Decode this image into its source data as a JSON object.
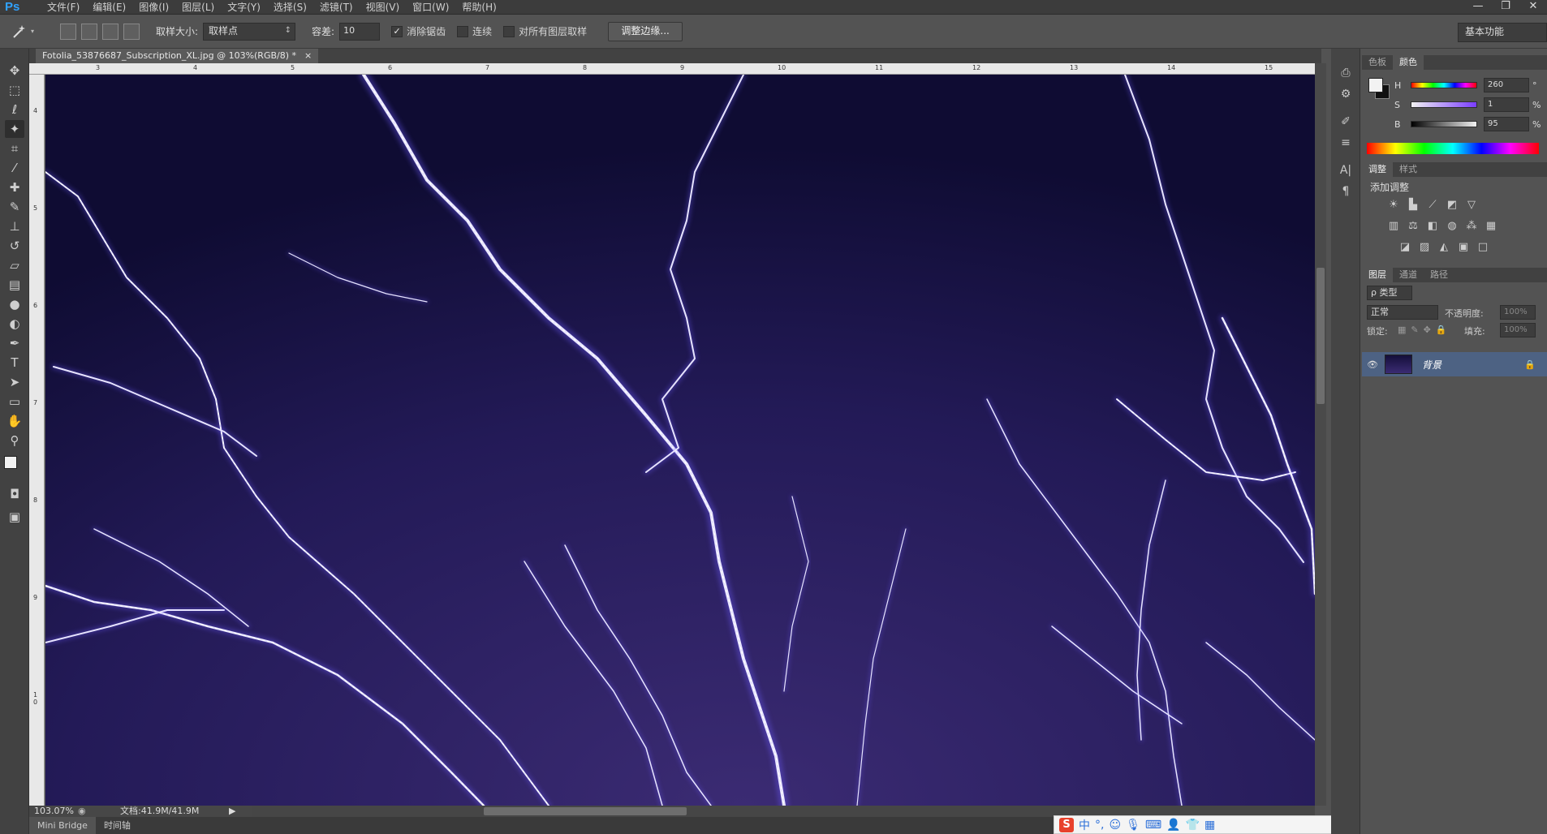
{
  "app": {
    "logo": "Ps"
  },
  "menu": [
    "文件(F)",
    "编辑(E)",
    "图像(I)",
    "图层(L)",
    "文字(Y)",
    "选择(S)",
    "滤镜(T)",
    "视图(V)",
    "窗口(W)",
    "帮助(H)"
  ],
  "window_controls": [
    "—",
    "❐",
    "✕"
  ],
  "options": {
    "sample_size_label": "取样大小:",
    "sample_size_value": "取样点",
    "tolerance_label": "容差:",
    "tolerance_value": "10",
    "antialias_label": "消除锯齿",
    "antialias_checked": true,
    "contiguous_label": "连续",
    "sample_all_label": "对所有图层取样",
    "refine_button": "调整边缘...",
    "workspace": "基本功能"
  },
  "document": {
    "tab_title": "Fotolia_53876687_Subscription_XL.jpg @ 103%(RGB/8) *",
    "close": "×",
    "ruler_top_ticks": [
      "3",
      "4",
      "5",
      "6",
      "7",
      "8",
      "9",
      "10",
      "11",
      "12",
      "13",
      "14",
      "15"
    ],
    "ruler_left_ticks": [
      "4",
      "5",
      "6",
      "7",
      "8",
      "9",
      "1\n0"
    ]
  },
  "status": {
    "zoom": "103.07%",
    "doc_size": "文档:41.9M/41.9M"
  },
  "bottom_tabs": [
    "Mini Bridge",
    "时间轴"
  ],
  "color_panel": {
    "tabs": [
      "色板",
      "颜色"
    ],
    "active_tab": "颜色",
    "rows": [
      {
        "label": "H",
        "value": "260",
        "unit": "°"
      },
      {
        "label": "S",
        "value": "1",
        "unit": "%"
      },
      {
        "label": "B",
        "value": "95",
        "unit": "%"
      }
    ]
  },
  "adjust_panel": {
    "tabs": [
      "调整",
      "样式"
    ],
    "title": "添加调整"
  },
  "layers_panel": {
    "tabs": [
      "图层",
      "通道",
      "路径"
    ],
    "filter_kind": "ρ 类型",
    "blend_mode": "正常",
    "opacity_label": "不透明度:",
    "opacity_value": "100%",
    "lock_label": "锁定:",
    "fill_label": "填充:",
    "fill_value": "100%",
    "layers": [
      {
        "name": "背景"
      }
    ]
  },
  "ime": {
    "logo": "S",
    "mode": "中"
  },
  "colors": {
    "canvas_bg": "#1e1748",
    "layer_selected": "#4d6283",
    "ps_blue": "#30a2ff",
    "lightning": "#e7e4ff"
  }
}
